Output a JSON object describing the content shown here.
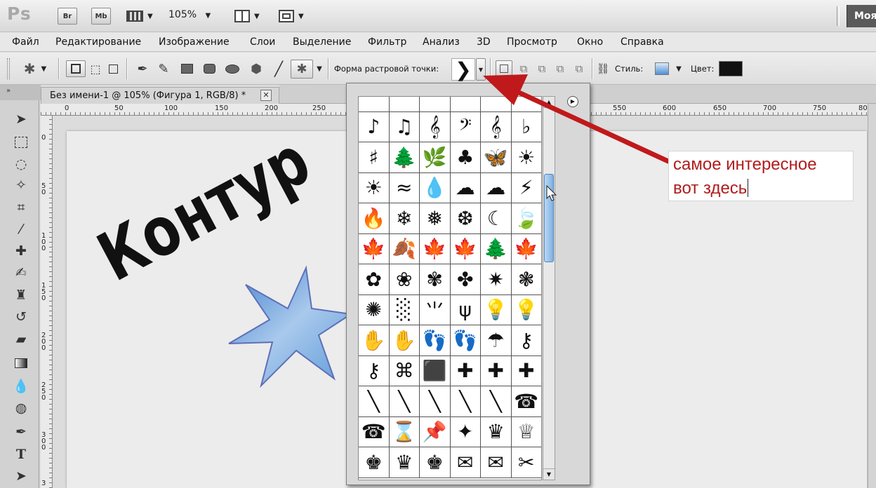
{
  "app": {
    "logo": "Ps",
    "bridge_label": "Br",
    "minibridge_label": "Mb",
    "zoom": "105%",
    "workspace": "Моя"
  },
  "menu": [
    "Файл",
    "Редактирование",
    "Изображение",
    "Слои",
    "Выделение",
    "Фильтр",
    "Анализ",
    "3D",
    "Просмотр",
    "Окно",
    "Справка"
  ],
  "options": {
    "shape_label": "Форма растровой точки:",
    "style_label": "Стиль:",
    "color_label": "Цвет:",
    "color_value": "#111111",
    "style_swatch_color": "#4d8fd4"
  },
  "document": {
    "tab_title": "Без имени-1 @ 105% (Фигура 1, RGB/8) *",
    "close_glyph": "✕",
    "canvas_text": "Контур",
    "star_color": "#5d9ad8"
  },
  "ruler_top": [
    "0",
    "50",
    "100",
    "150",
    "200",
    "250",
    "550",
    "600",
    "650",
    "700",
    "750",
    "80"
  ],
  "ruler_left": [
    "0",
    "5 0",
    "1 0 0",
    "1 5 0",
    "2 0 0",
    "2 5 0",
    "3 0 0",
    "3"
  ],
  "shape_picker": {
    "shapes": [
      "♪",
      "♫",
      "𝄞",
      "𝄢",
      "𝄞",
      "♭",
      "♯",
      "🌲",
      "🌿",
      "♣",
      "🦋",
      "☀",
      "☀",
      "≈",
      "💧",
      "☁",
      "☁",
      "⚡",
      "🔥",
      "❄",
      "❅",
      "❆",
      "☾",
      "🍃",
      "🍁",
      "🍂",
      "🍁",
      "🍁",
      "🌲",
      "🍁",
      "✿",
      "❀",
      "✾",
      "✤",
      "✷",
      "❃",
      "✺",
      "░",
      "⺌",
      "ψ",
      "💡",
      "💡",
      "✋",
      "✋",
      "👣",
      "👣",
      "☂",
      "⚷",
      "⚷",
      "⌘",
      "⬛",
      "✚",
      "✚",
      "✚",
      "╲",
      "╲",
      "╲",
      "╲",
      "╲",
      "☎",
      "☎",
      "⌛",
      "📌",
      "✦",
      "♛",
      "♕",
      "♚",
      "♛",
      "♚",
      "✉",
      "✉",
      "✂"
    ]
  },
  "annotation": {
    "line1": "самое интересное",
    "line2": "вот здесь",
    "color": "#c0191b"
  }
}
